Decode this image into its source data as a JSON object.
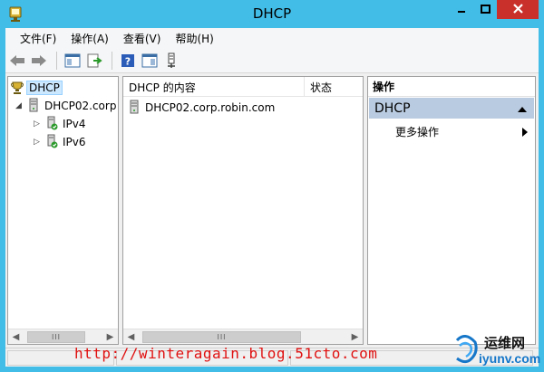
{
  "window": {
    "title": "DHCP",
    "min_glyph": "▬",
    "max_glyph": "□",
    "close_glyph": "✕"
  },
  "menubar": {
    "items": [
      "文件(F)",
      "操作(A)",
      "查看(V)",
      "帮助(H)"
    ]
  },
  "toolbar": {
    "buttons": [
      "back-icon",
      "forward-icon",
      "show-hide-console-tree-icon",
      "export-list-icon",
      "help-icon",
      "show-hide-action-pane-icon",
      "add-server-icon"
    ]
  },
  "tree": {
    "root": "DHCP",
    "server": "DHCP02.corp",
    "children": [
      "IPv4",
      "IPv6"
    ]
  },
  "list": {
    "columns": [
      "DHCP 的内容",
      "状态"
    ],
    "rows": [
      {
        "name": "DHCP02.corp.robin.com",
        "status": ""
      }
    ]
  },
  "actions": {
    "header": "操作",
    "section": "DHCP",
    "more": "更多操作"
  },
  "scroll": {
    "thumb_glyph": "III"
  },
  "watermark": {
    "url": "http://winteragain.blog.51cto.com",
    "brand_cn": "运维网",
    "brand_en": "iyunv.com"
  },
  "colors": {
    "titlebar": "#42bde8",
    "close": "#c9302c",
    "selection": "#cce8ff",
    "action_section": "#b9cbe0",
    "watermark": "#e01010"
  }
}
